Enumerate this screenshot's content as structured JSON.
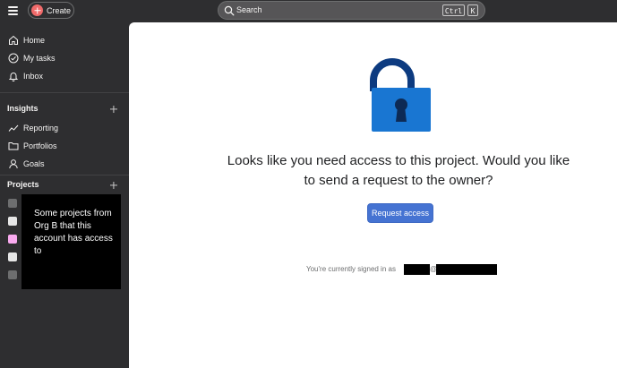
{
  "topbar": {
    "create_label": "Create",
    "search_label": "Search",
    "shortcut_keys": [
      "Ctrl",
      "K"
    ]
  },
  "sidebar": {
    "nav": [
      {
        "label": "Home",
        "icon": "home-icon"
      },
      {
        "label": "My tasks",
        "icon": "check-circle-icon"
      },
      {
        "label": "Inbox",
        "icon": "bell-icon"
      }
    ],
    "insights": {
      "title": "Insights",
      "items": [
        {
          "label": "Reporting",
          "icon": "trend-line-icon"
        },
        {
          "label": "Portfolios",
          "icon": "folder-icon"
        },
        {
          "label": "Goals",
          "icon": "person-icon"
        }
      ]
    },
    "projects": {
      "title": "Projects",
      "dot_colors": [
        "#6d6e6f",
        "#e6e6e6",
        "#f9aaef",
        "#e6e6e6",
        "#6d6e6f"
      ],
      "annotation": "Some projects from Org B that this account has access to"
    }
  },
  "main": {
    "lock_icon": "padlock-icon",
    "headline": "Looks like you need access to this project. Would you like to send a request to the owner?",
    "request_button": "Request access",
    "signed_in_text": "You're currently signed in as",
    "at": "@"
  },
  "colors": {
    "sidebar_bg": "#2e2e30",
    "accent_button": "#4573d2",
    "create_plus": "#f06a6a",
    "lock_body": "#1976d2",
    "lock_shackle": "#0d3b80"
  }
}
